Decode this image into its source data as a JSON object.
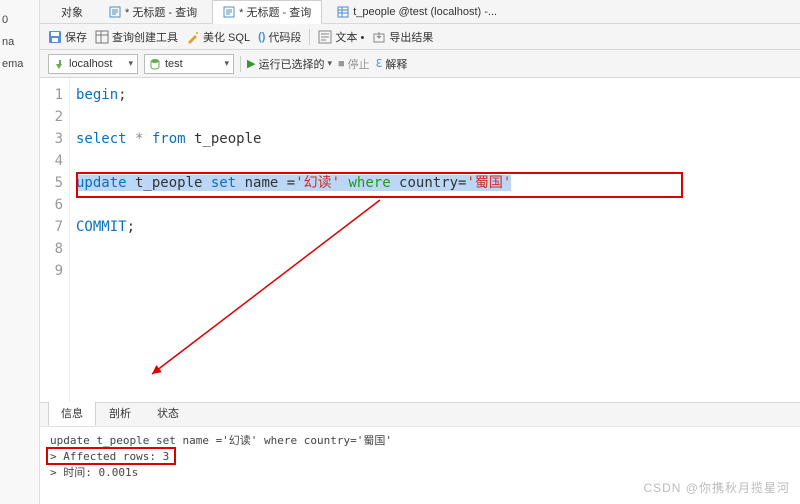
{
  "sidebar": {
    "items": [
      "0",
      "na",
      "ema"
    ],
    "active_index": 2
  },
  "tabs": [
    {
      "label": "对象"
    },
    {
      "label": "* 无标题 - 查询"
    },
    {
      "label": "* 无标题 - 查询",
      "active": true
    },
    {
      "label": "t_people @test (localhost) -..."
    }
  ],
  "toolbar": {
    "save": "保存",
    "builder": "查询创建工具",
    "beautify": "美化 SQL",
    "codesnippet": "代码段",
    "text": "文本 •",
    "export": "导出结果"
  },
  "connrow": {
    "conn": "localhost",
    "db": "test",
    "run_selected": "运行已选择的",
    "dropdown": " ",
    "stop": "停止",
    "explain": "解释"
  },
  "editor": {
    "lines": [
      "1",
      "2",
      "3",
      "4",
      "5",
      "6",
      "7",
      "8",
      "9"
    ],
    "l1_kw": "begin",
    "l1_semi": ";",
    "l3_select": "select",
    "l3_star": " * ",
    "l3_from": "from",
    "l3_tbl": " t_people",
    "l5_update": "update",
    "l5_tbl": " t_people ",
    "l5_set": "set",
    "l5_name": " name =",
    "l5_s1": "'幻读'",
    "l5_where": " where",
    "l5_country": " country=",
    "l5_s2": "'蜀国'",
    "l7_commit": "COMMIT",
    "l7_semi": ";"
  },
  "bottom_tabs": [
    {
      "label": "信息",
      "active": true
    },
    {
      "label": "剖析"
    },
    {
      "label": "状态"
    }
  ],
  "output": {
    "line1": "update t_people set name ='幻读' where country='蜀国'",
    "line2": "> Affected rows: 3",
    "line3": "> 时间: 0.001s"
  },
  "watermark": "CSDN @你携秋月揽星河"
}
